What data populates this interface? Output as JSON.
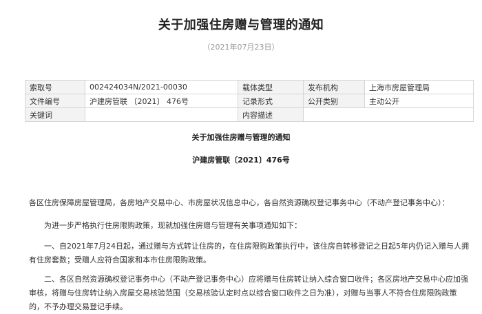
{
  "header": {
    "title": "关于加强住房赠与管理的通知",
    "date": "（2021年07月23日）"
  },
  "meta": {
    "rows": [
      [
        {
          "label": "索取号",
          "value": "002424034N/2021-00030"
        },
        {
          "label": "载体类型",
          "value": ""
        },
        {
          "label": "发布机构",
          "value": "上海市房屋管理局"
        }
      ],
      [
        {
          "label": "文件编号",
          "value": "沪建房管联 〔2021〕 476号"
        },
        {
          "label": "记录形式",
          "value": ""
        },
        {
          "label": "公开类别",
          "value": "主动公开"
        }
      ],
      [
        {
          "label": "关键词",
          "value": ""
        },
        {
          "label": "内容描述",
          "value": ""
        }
      ]
    ]
  },
  "body": {
    "doc_title": "关于加强住房赠与管理的通知",
    "doc_number": "沪建房管联〔2021〕476号",
    "salutation": "各区住房保障房屋管理局，各房地产交易中心、市房屋状况信息中心，各自然资源确权登记事务中心（不动产登记事务中心）：",
    "intro": "为进一步严格执行住房限购政策，现就加强住房赠与管理有关事项通知如下：",
    "item1": "一、自2021年7月24日起，通过赠与方式转让住房的，在住房限购政策执行中，该住房自转移登记之日起5年内仍记入赠与人拥有住房套数；受赠人应符合国家和本市住房限购政策。",
    "item2": "二、各区自然资源确权登记事务中心（不动产登记事务中心）应将赠与住房转让纳入综合窗口收件；各区房地产交易中心应加强审核，将赠与住房转让纳入房屋交易核验范围（交易核验认定时点以综合窗口收件之日为准），对赠与当事人不符合住房限购政策的，不予办理交易登记手续。"
  }
}
